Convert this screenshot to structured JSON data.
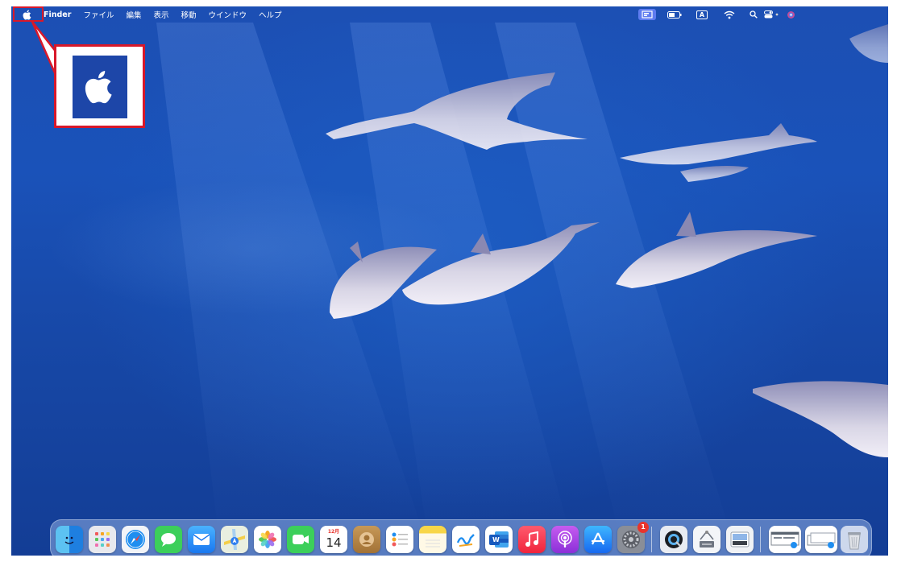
{
  "menubar": {
    "app_name": "Finder",
    "items": [
      "ファイル",
      "編集",
      "表示",
      "移動",
      "ウインドウ",
      "ヘルプ"
    ],
    "input_method": "A"
  },
  "dock": {
    "calendar_month": "12月",
    "calendar_day": "14",
    "word_label": "W",
    "settings_badge": "1",
    "apps": [
      "finder",
      "launchpad",
      "safari",
      "messages",
      "mail",
      "maps",
      "photos",
      "facetime",
      "calendar",
      "contacts",
      "reminders",
      "notes",
      "freeform",
      "word",
      "music",
      "podcasts",
      "app-store",
      "system-settings",
      "quicktime",
      "screenshot-tool",
      "preview",
      "downloads-stack",
      "documents-stack",
      "trash"
    ]
  },
  "colors": {
    "highlight": "#d8182a",
    "desktop": "#1a52b9",
    "menubar_active": "#5e7cf0"
  }
}
